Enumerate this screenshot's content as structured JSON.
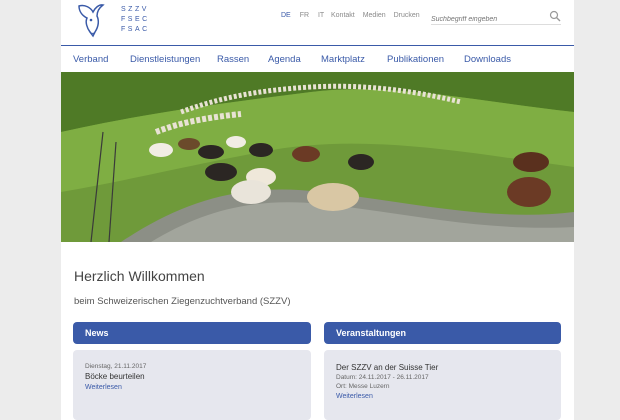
{
  "brand": {
    "lines": [
      "SZZV",
      "FSEC",
      "FSAC"
    ],
    "accent_color": "#3a5aa8"
  },
  "languages": [
    {
      "label": "DE",
      "active": true
    },
    {
      "label": "FR",
      "active": false
    },
    {
      "label": "IT",
      "active": false
    }
  ],
  "utility_links": [
    "Kontakt",
    "Medien",
    "Drucken"
  ],
  "search": {
    "placeholder": "Suchbegriff eingeben",
    "icon": "search-icon"
  },
  "nav": [
    "Verband",
    "Dienstleistungen",
    "Rassen",
    "Agenda",
    "Marktplatz",
    "Publikationen",
    "Downloads"
  ],
  "hero": {
    "subject": "herd of goats on alpine pasture"
  },
  "welcome": {
    "title": "Herzlich Willkommen",
    "subtitle": "beim Schweizerischen Ziegenzuchtverband (SZZV)"
  },
  "news": {
    "heading": "News",
    "date": "Dienstag, 21.11.2017",
    "title": "Böcke beurteilen",
    "link": "Weiterlesen"
  },
  "events": {
    "heading": "Veranstaltungen",
    "title": "Der SZZV an der Suisse Tier",
    "date": "Datum: 24.11.2017 - 26.11.2017",
    "location": "Ort: Messe Luzern",
    "link": "Weiterlesen"
  }
}
